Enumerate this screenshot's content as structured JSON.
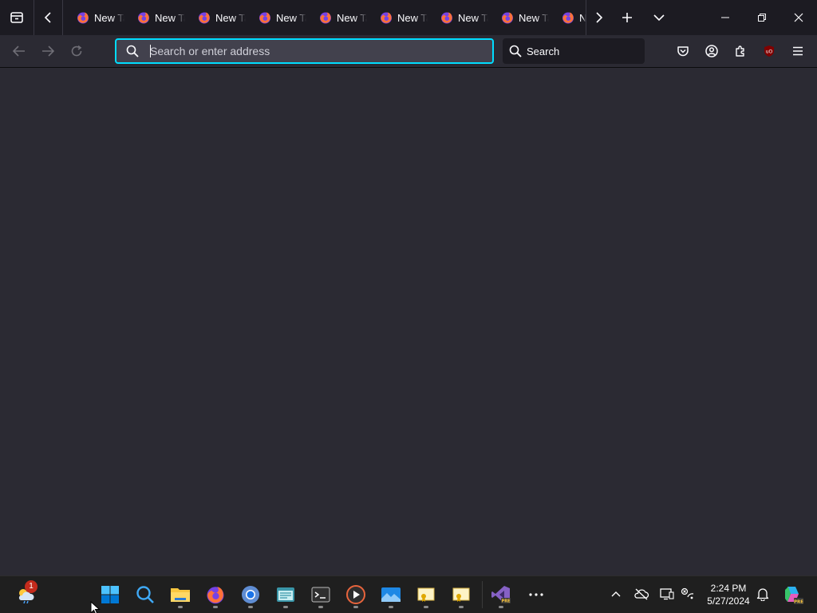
{
  "browser": {
    "tabs": [
      {
        "title": "New Tab"
      },
      {
        "title": "New Tab"
      },
      {
        "title": "New Tab"
      },
      {
        "title": "New Tab"
      },
      {
        "title": "New Tab"
      },
      {
        "title": "New Tab"
      },
      {
        "title": "New Tab"
      },
      {
        "title": "New Tab"
      },
      {
        "title": "N"
      }
    ],
    "urlbar": {
      "placeholder": "Search or enter address",
      "value": ""
    },
    "searchbar": {
      "label": "Search"
    },
    "toolbar_icons": [
      "pocket-icon",
      "account-icon",
      "extensions-icon",
      "ublock-origin-icon",
      "menu-icon"
    ]
  },
  "taskbar": {
    "weather_badge": "1",
    "apps": [
      "windows-start",
      "search",
      "file-explorer",
      "firefox",
      "chrome",
      "notepad",
      "terminal",
      "media-player",
      "photos",
      "certificate-a",
      "certificate-b",
      "visual-studio-preview",
      "more"
    ],
    "clock": {
      "time": "2:24 PM",
      "date": "5/27/2024"
    }
  },
  "colors": {
    "accent": "#00ddff",
    "tab_strip": "#1c1b22",
    "toolbar": "#2b2a33",
    "urlbar": "#42414d",
    "taskbar": "#1f1f1f"
  }
}
